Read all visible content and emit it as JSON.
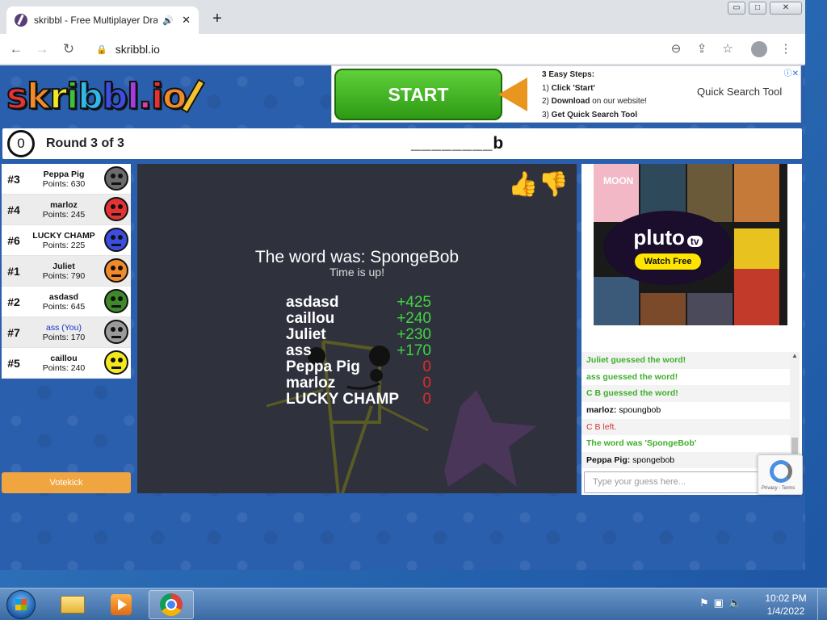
{
  "browser": {
    "tab_title": "skribbl - Free Multiplayer Dra",
    "tab_audio_icon": "speaker-icon",
    "url": "skribbl.io",
    "window_buttons": [
      "▭",
      "□",
      "✕"
    ]
  },
  "game": {
    "logo_text": "skribbl.io",
    "timer": "0",
    "round_label": "Round 3 of 3",
    "word_hint": "________b",
    "players": [
      {
        "rank": "#3",
        "name": "Peppa Pig",
        "points": "Points: 630",
        "color": "#6b6b6b",
        "you": false
      },
      {
        "rank": "#4",
        "name": "marloz",
        "points": "Points: 245",
        "color": "#e53232",
        "you": false
      },
      {
        "rank": "#6",
        "name": "LUCKY CHAMP",
        "points": "Points: 225",
        "color": "#3b4ee0",
        "you": false
      },
      {
        "rank": "#1",
        "name": "Juliet",
        "points": "Points: 790",
        "color": "#f08a2a",
        "you": false
      },
      {
        "rank": "#2",
        "name": "asdasd",
        "points": "Points: 645",
        "color": "#3e8a2a",
        "you": false
      },
      {
        "rank": "#7",
        "name": "ass (You)",
        "points": "Points: 170",
        "color": "#9a9a9a",
        "you": true
      },
      {
        "rank": "#5",
        "name": "caillou",
        "points": "Points: 240",
        "color": "#f3e91f",
        "you": false
      }
    ],
    "overlay": {
      "title": "The word was: SpongeBob",
      "subtitle": "Time is up!",
      "scores": [
        {
          "name": "asdasd",
          "delta": "+425",
          "positive": true
        },
        {
          "name": "caillou",
          "delta": "+240",
          "positive": true
        },
        {
          "name": "Juliet",
          "delta": "+230",
          "positive": true
        },
        {
          "name": "ass",
          "delta": "+170",
          "positive": true
        },
        {
          "name": "Peppa Pig",
          "delta": "0",
          "positive": false
        },
        {
          "name": "marloz",
          "delta": "0",
          "positive": false
        },
        {
          "name": "LUCKY CHAMP",
          "delta": "0",
          "positive": false
        }
      ]
    },
    "votekick_label": "Votekick",
    "chat": [
      {
        "type": "green",
        "text": "Juliet guessed the word!"
      },
      {
        "type": "green",
        "text": "ass guessed the word!"
      },
      {
        "type": "green",
        "text": "C B guessed the word!"
      },
      {
        "type": "user",
        "who": "marloz:",
        "text": " spoungbob"
      },
      {
        "type": "red",
        "text": "C B left."
      },
      {
        "type": "green",
        "text": "The word was 'SpongeBob'"
      },
      {
        "type": "user",
        "who": "Peppa Pig:",
        "text": " spongebob"
      }
    ],
    "chat_placeholder": "Type your guess here..."
  },
  "ad": {
    "start_label": "START",
    "steps_heading": "3 Easy Steps:",
    "step1_num": "1) ",
    "step1_bold": "Click 'Start'",
    "step2_num": "2) ",
    "step2_bold": "Download",
    "step2_rest": " on our website!",
    "step3_num": "3) ",
    "step3_bold": "Get Quick Search Tool",
    "brand": "Quick Search Tool",
    "close": "ⓘ✕"
  },
  "side_ad": {
    "logo": "pluto",
    "logo_suffix": "tv",
    "cta": "Watch Free",
    "poster_text": "MOON"
  },
  "taskbar": {
    "time": "10:02 PM",
    "date": "1/4/2022",
    "tray_icons": [
      "flag-icon",
      "network-icon",
      "volume-icon"
    ]
  }
}
